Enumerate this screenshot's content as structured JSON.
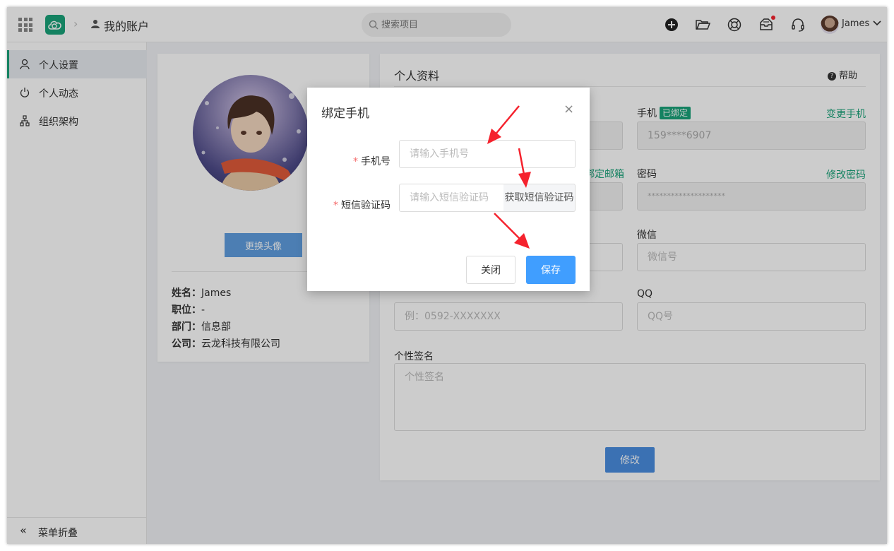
{
  "header": {
    "breadcrumb_sep": "›",
    "title": "我的账户",
    "search_placeholder": "搜索项目",
    "user_name": "James"
  },
  "sidebar": {
    "items": [
      {
        "label": "个人设置",
        "icon": "user-icon",
        "active": true
      },
      {
        "label": "个人动态",
        "icon": "power-icon",
        "active": false
      },
      {
        "label": "组织架构",
        "icon": "org-chart-icon",
        "active": false
      }
    ],
    "collapse_icon": "«",
    "collapse_label": "菜单折叠"
  },
  "profile": {
    "change_avatar": "更换头像",
    "fields": [
      {
        "key": "姓名：",
        "value": "James"
      },
      {
        "key": "职位：",
        "value": "-"
      },
      {
        "key": "部门：",
        "value": "信息部"
      },
      {
        "key": "公司：",
        "value": "云龙科技有限公司"
      }
    ]
  },
  "main": {
    "title": "个人资料",
    "help": "帮助",
    "bind_email_link": "绑定邮箱",
    "phone_label": "手机",
    "phone_badge": "已绑定",
    "phone_change_link": "变更手机",
    "phone_value": "159****6907",
    "password_label": "密码",
    "password_change_link": "修改密码",
    "password_value": "********************",
    "wechat_label": "微信",
    "wechat_placeholder": "微信号",
    "tel_placeholder": "例：0592-XXXXXXX",
    "qq_label": "QQ",
    "qq_placeholder": "QQ号",
    "signature_label": "个性签名",
    "signature_placeholder": "个性签名",
    "submit": "修改"
  },
  "modal": {
    "title": "绑定手机",
    "close_icon": "×",
    "required_mark": "*",
    "phone_label": "手机号",
    "phone_placeholder": "请输入手机号",
    "sms_label": "短信验证码",
    "sms_placeholder": "请输入短信验证码",
    "sms_button": "获取短信验证码",
    "close_button": "关闭",
    "save_button": "保存"
  },
  "colors": {
    "brand": "#1aa37a",
    "primary_button": "#409eff",
    "arrow": "#f5222d"
  }
}
